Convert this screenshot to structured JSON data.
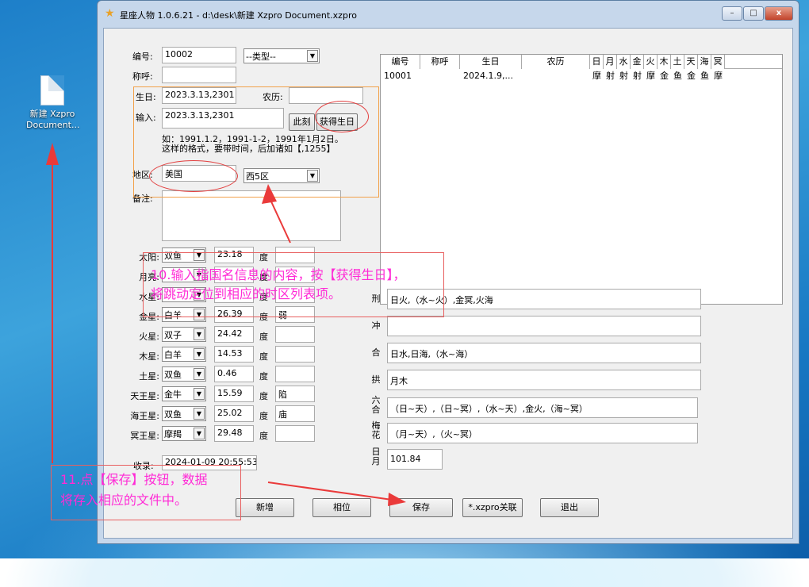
{
  "desktop": {
    "icon_label_line1": "新建 Xzpro",
    "icon_label_line2": "Document..."
  },
  "window": {
    "title": "星座人物 1.0.6.21   -   d:\\desk\\新建 Xzpro Document.xzpro",
    "min": "–",
    "max": "□",
    "close": "x"
  },
  "form": {
    "id_label": "编号:",
    "id_value": "10002",
    "type_value": "--类型--",
    "name_label": "称呼:",
    "name_value": "",
    "birth_label": "生日:",
    "birth_value": "2023.3.13,2301",
    "lunar_label": "农历:",
    "lunar_value": "",
    "input_label": "输入:",
    "input_value": "2023.3.13,2301",
    "now_btn": "此刻",
    "get_birth_btn": "获得生日",
    "hint_line1": "如：1991.1.2，1991-1-2，1991年1月2日。",
    "hint_line2": "这样的格式，要带时间，后加诸如【,1255】",
    "region_label": "地区:",
    "region_value": "美国",
    "zone_value": "西5区",
    "note_label": "备注:"
  },
  "planets": [
    {
      "label": "太阳:",
      "sign": "双鱼",
      "deg": "23.18",
      "unit": "度",
      "extra": ""
    },
    {
      "label": "月亮:",
      "sign": "",
      "deg": "",
      "unit": "度",
      "extra": ""
    },
    {
      "label": "水星:",
      "sign": "",
      "deg": "",
      "unit": "度",
      "extra": ""
    },
    {
      "label": "金星:",
      "sign": "白羊",
      "deg": "26.39",
      "unit": "度",
      "extra": "弱"
    },
    {
      "label": "火星:",
      "sign": "双子",
      "deg": "24.42",
      "unit": "度",
      "extra": ""
    },
    {
      "label": "木星:",
      "sign": "白羊",
      "deg": "14.53",
      "unit": "度",
      "extra": ""
    },
    {
      "label": "土星:",
      "sign": "双鱼",
      "deg": "0.46",
      "unit": "度",
      "extra": ""
    },
    {
      "label": "天王星:",
      "sign": "金牛",
      "deg": "15.59",
      "unit": "度",
      "extra": "陷"
    },
    {
      "label": "海王星:",
      "sign": "双鱼",
      "deg": "25.02",
      "unit": "度",
      "extra": "庙"
    },
    {
      "label": "冥王星:",
      "sign": "摩羯",
      "deg": "29.48",
      "unit": "度",
      "extra": ""
    }
  ],
  "recorded": {
    "label": "收录:",
    "value": "2024-01-09 20:55:53"
  },
  "table": {
    "headers": [
      "编号",
      "称呼",
      "生日",
      "农历",
      "日",
      "月",
      "水",
      "金",
      "火",
      "木",
      "土",
      "天",
      "海",
      "冥"
    ],
    "rows": [
      [
        "10001",
        "",
        "2024.1.9,...",
        "",
        "摩",
        "射",
        "射",
        "射",
        "摩",
        "金",
        "鱼",
        "金",
        "鱼",
        "摩"
      ]
    ]
  },
  "relations": [
    {
      "label": "刑",
      "value": "日火,（水~火）,金冥,火海"
    },
    {
      "label": "冲",
      "value": ""
    },
    {
      "label": "合",
      "value": "日水,日海,（水~海）"
    },
    {
      "label": "拱",
      "value": "月木"
    },
    {
      "label": "六合",
      "value": "（日~天）,（日~冥）,（水~天）,金火,（海~冥）"
    },
    {
      "label": "梅花",
      "value": "（月~天）,（火~冥）"
    },
    {
      "label": "日月",
      "value": "101.84"
    }
  ],
  "buttons": {
    "new": "新增",
    "match": "相位",
    "save": "保存",
    "assoc": "*.xzpro关联",
    "exit": "退出"
  },
  "annotations": {
    "step10_line1": "10.输入指国名信息的内容，按【获得生日】，",
    "step10_line2": "将跳动定位到相应的时区列表项。",
    "step11_line1": "11.点【保存】按钮，数据",
    "step11_line2": "将存入相应的文件中。"
  }
}
